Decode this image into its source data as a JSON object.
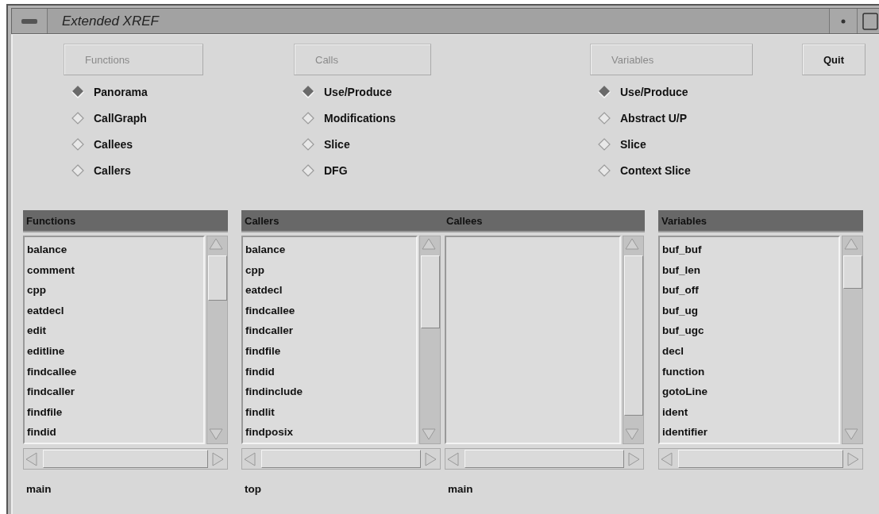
{
  "window": {
    "title": "Extended XREF"
  },
  "groups": [
    {
      "title": "Functions",
      "disabled": true,
      "options": [
        {
          "label": "Panorama",
          "selected": true
        },
        {
          "label": "CallGraph",
          "selected": false
        },
        {
          "label": "Callees",
          "selected": false
        },
        {
          "label": "Callers",
          "selected": false
        }
      ]
    },
    {
      "title": "Calls",
      "disabled": true,
      "options": [
        {
          "label": "Use/Produce",
          "selected": true
        },
        {
          "label": "Modifications",
          "selected": false
        },
        {
          "label": "Slice",
          "selected": false
        },
        {
          "label": "DFG",
          "selected": false
        }
      ]
    },
    {
      "title": "Variables",
      "disabled": true,
      "options": [
        {
          "label": "Use/Produce",
          "selected": true
        },
        {
          "label": "Abstract U/P",
          "selected": false
        },
        {
          "label": "Slice",
          "selected": false
        },
        {
          "label": "Context Slice",
          "selected": false
        }
      ]
    }
  ],
  "quit_button": {
    "label": "Quit",
    "disabled": false
  },
  "panels": [
    {
      "columns": [
        {
          "heading": "Functions",
          "items": [
            "balance",
            "comment",
            "cpp",
            "eatdecl",
            "edit",
            "editline",
            "findcallee",
            "findcaller",
            "findfile",
            "findid"
          ],
          "footer": "main"
        }
      ]
    },
    {
      "columns": [
        {
          "heading": "Callers",
          "items": [
            "balance",
            "cpp",
            "eatdecl",
            "findcallee",
            "findcaller",
            "findfile",
            "findid",
            "findinclude",
            "findlit",
            "findposix"
          ],
          "footer": "top"
        },
        {
          "heading": "Callees",
          "footer": "main"
        }
      ]
    },
    {
      "columns": [
        {
          "heading": "Variables",
          "items": [
            "buf_buf",
            "buf_len",
            "buf_off",
            "buf_ug",
            "buf_ugc",
            "decl",
            "function",
            "gotoLine",
            "ident",
            "identifier"
          ]
        }
      ]
    }
  ]
}
